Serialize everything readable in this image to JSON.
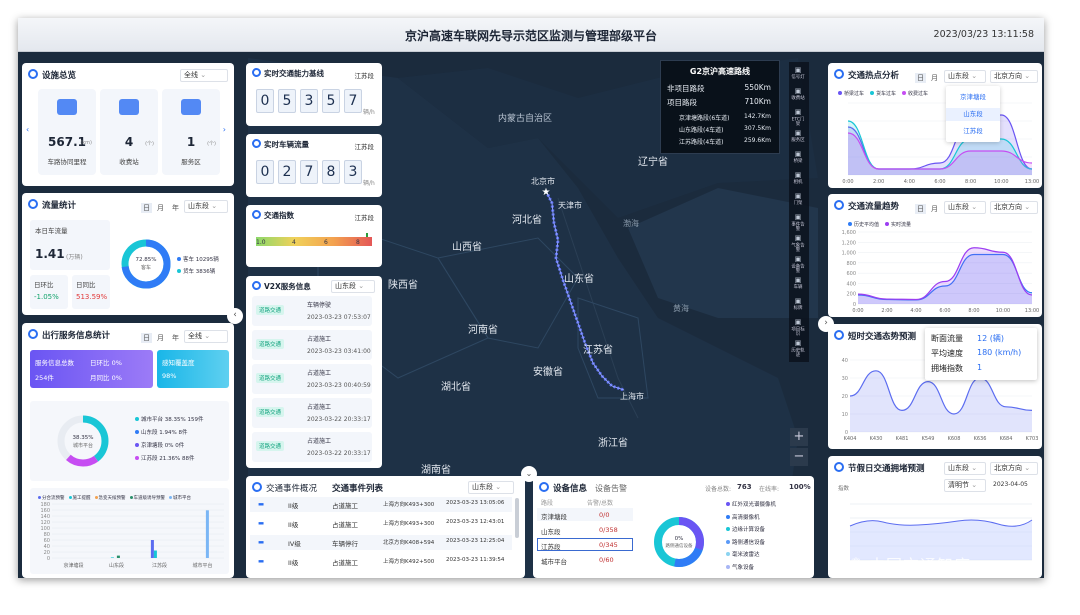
{
  "header": {
    "title": "京沪高速车联网先导示范区监测与管理部级平台",
    "datetime": "2023/03/23 13:11:58"
  },
  "facilities": {
    "title": "设施总览",
    "selector": "全线",
    "items": [
      {
        "value": "567.1",
        "unit": "(km)",
        "label": "车路协同里程"
      },
      {
        "value": "4",
        "unit": "(个)",
        "label": "收费站"
      },
      {
        "value": "1",
        "unit": "(个)",
        "label": "服务区"
      }
    ]
  },
  "flow": {
    "title": "流量统计",
    "tabs": [
      "日",
      "月",
      "年"
    ],
    "selector": "山东段",
    "today_label": "本日车流量",
    "today_value": "1.41",
    "today_unit": "(万辆)",
    "ring_label": "72.85%",
    "ring_sub": "客车",
    "legend": [
      {
        "name": "客车 10295辆",
        "color": "#2f7cf6"
      },
      {
        "name": "货车 3836辆",
        "color": "#19c6d6"
      }
    ],
    "mom_label": "日环比",
    "mom_value": "-1.05%",
    "yoy_label": "日同比",
    "yoy_value": "513.59%"
  },
  "travel": {
    "title": "出行服务信息统计",
    "tabs": [
      "日",
      "月",
      "年"
    ],
    "selector": "全线",
    "card1_title": "服务信息总数",
    "card1_count": "254件",
    "card1_mom": "日环比 0%",
    "card1_yoy": "月同比 0%",
    "card2_title": "感知覆盖度",
    "card2_value": "98%",
    "ring_label": "38.35%",
    "ring_sub": "城市平台",
    "legend": [
      "城市平台 38.35% 159件",
      "山东段 1.94% 8件",
      "京津塘段 0% 0件",
      "江苏段 21.36% 88件"
    ],
    "bar_legend": [
      "分合流预警",
      "施工提醒",
      "急变天候预警",
      "车道级诱导预警",
      "城市平台"
    ],
    "bar_yticks": [
      "180",
      "160",
      "140",
      "120",
      "100",
      "80",
      "60",
      "40",
      "20",
      "0"
    ],
    "bar_x": [
      "京津塘段",
      "山东段",
      "江苏段",
      "城市平台"
    ]
  },
  "capacity": {
    "title": "实时交通能力基线",
    "selector": "江苏段",
    "digits": [
      "0",
      "5",
      "3",
      "5",
      "7"
    ],
    "unit": "辆/h"
  },
  "vehicle": {
    "title": "实时车辆流量",
    "selector": "江苏段",
    "digits": [
      "0",
      "2",
      "7",
      "8",
      "3"
    ],
    "unit": "辆/h"
  },
  "index": {
    "title": "交通指数",
    "selector": "江苏段",
    "ticks": [
      "1.0",
      "4",
      "6",
      "8"
    ]
  },
  "v2x": {
    "title": "V2X服务信息",
    "selector": "山东段",
    "items": [
      {
        "badge": "道路交通",
        "text": "车辆停驶",
        "time": "2023-03-23 07:53:07"
      },
      {
        "badge": "道路交通",
        "text": "占道施工",
        "time": "2023-03-23 03:41:00"
      },
      {
        "badge": "道路交通",
        "text": "占道施工",
        "time": "2023-03-23 00:40:59"
      },
      {
        "badge": "道路交通",
        "text": "占道施工",
        "time": "2023-03-22 20:33:17"
      },
      {
        "badge": "道路交通",
        "text": "占道施工",
        "time": "2023-03-22 20:33:17"
      }
    ]
  },
  "route": {
    "title": "G2京沪高速路线",
    "rows": [
      {
        "k": "非项目路段",
        "v": "550Km"
      },
      {
        "k": "项目路段",
        "v": "710Km"
      },
      {
        "k": "京津塘路段(6车道)",
        "v": "142.7Km"
      },
      {
        "k": "山东路段(4车道)",
        "v": "307.5Km"
      },
      {
        "k": "江苏路段(4车道)",
        "v": "259.6Km"
      }
    ]
  },
  "map": {
    "labels": [
      "内蒙古自治区",
      "北京市",
      "天津市",
      "河北省",
      "辽宁省",
      "山西省",
      "陕西省",
      "山东省",
      "河南省",
      "黄海",
      "江苏省",
      "安徽省",
      "湖北省",
      "上海市",
      "浙江省",
      "湖南省",
      "渤海"
    ]
  },
  "iconbar": [
    "信号灯",
    "收费站",
    "ETC门架",
    "服务区",
    "桥梁",
    "相机",
    "门架",
    "事件告警",
    "气象告警",
    "设备告警",
    "车辆",
    "标牌",
    "项目标识",
    "历史轨迹"
  ],
  "events": {
    "tabs": [
      "交通事件概况",
      "交通事件列表"
    ],
    "selector": "山东段",
    "rows": [
      {
        "level": "II级",
        "type": "占道施工",
        "place": "上海方向K493+300",
        "time": "2023-03-23 13:05:06"
      },
      {
        "level": "II级",
        "type": "占道施工",
        "place": "上海方向K493+300",
        "time": "2023-03-23 12:43:01"
      },
      {
        "level": "IV级",
        "type": "车辆停行",
        "place": "北京方向K408+594",
        "time": "2023-03-23 12:25:04"
      },
      {
        "level": "II级",
        "type": "占道施工",
        "place": "上海方向K492+500",
        "time": "2023-03-23 11:39:54"
      }
    ]
  },
  "devices": {
    "title": "设备信息",
    "tab2": "设备告警",
    "total_label": "设备总数:",
    "total": "763",
    "online_label": "在线率:",
    "online": "100%",
    "col1": "路段",
    "col2": "告警/总数",
    "rows": [
      {
        "name": "京津塘段",
        "v": "0/0"
      },
      {
        "name": "山东段",
        "v": "0/358"
      },
      {
        "name": "江苏段",
        "v": "0/345"
      },
      {
        "name": "城市平台",
        "v": "0/60"
      }
    ],
    "ring_label": "0%",
    "ring_sub": "路侧通信设备",
    "legend": [
      "红外双光谱摄像机",
      "高清摄像机",
      "边缘计算设备",
      "路侧通信设备",
      "毫米波雷达",
      "气象设备"
    ]
  },
  "hotspot": {
    "title": "交通热点分析",
    "tabs": [
      "日",
      "月"
    ],
    "selector": "山东段",
    "dir": "北京方向",
    "legend": [
      "桥梁过车",
      "货车过车",
      "收费过车"
    ],
    "dropdown": [
      "京津塘段",
      "山东段",
      "江苏段"
    ],
    "xticks": [
      "0:00",
      "2:00",
      "4:00",
      "6:00",
      "8:00",
      "10:00",
      "13:00"
    ]
  },
  "trend": {
    "title": "交通流量趋势",
    "tabs": [
      "日",
      "月"
    ],
    "selector": "山东段",
    "dir": "北京方向",
    "legend": [
      "历史平均值",
      "实时流量"
    ],
    "yticks": [
      "1,600",
      "1,200",
      "1,000",
      "800",
      "600",
      "400",
      "200",
      "0"
    ],
    "xticks": [
      "0:00",
      "2:00",
      "4:00",
      "6:00",
      "8:00",
      "10:00",
      "13:00"
    ]
  },
  "short": {
    "title": "短时交通态势预测",
    "tooltip": [
      {
        "k": "断面流量",
        "v": "12 (辆)"
      },
      {
        "k": "平均速度",
        "v": "180 (km/h)"
      },
      {
        "k": "拥堵指数",
        "v": "1"
      }
    ],
    "yticks": [
      "40",
      "30",
      "20",
      "10",
      "0"
    ],
    "xticks": [
      "K404",
      "K430",
      "K481",
      "K549",
      "K608",
      "K636",
      "K684",
      "K703"
    ]
  },
  "holiday": {
    "title": "节假日交通拥堵预测",
    "selector": "山东段",
    "dir": "北京方向",
    "sel2": "清明节",
    "date": "2023-04-05",
    "ylabel": "指数"
  },
  "watermark": "中国交通智库",
  "chart_data": [
    {
      "type": "area",
      "title": "交通热点分析",
      "x": [
        "0:00",
        "2:00",
        "4:00",
        "6:00",
        "8:00",
        "10:00",
        "13:00"
      ],
      "series": [
        {
          "name": "桥梁过车",
          "values": [
            8,
            1,
            1,
            2,
            9,
            10,
            1
          ]
        },
        {
          "name": "货车过车",
          "values": [
            9,
            1,
            1,
            1,
            6,
            6,
            1
          ]
        },
        {
          "name": "收费过车",
          "values": [
            7,
            1,
            1,
            1,
            4,
            4,
            2
          ]
        }
      ],
      "ylim": [
        0,
        12
      ]
    },
    {
      "type": "area",
      "title": "交通流量趋势",
      "x": [
        "0:00",
        "2:00",
        "4:00",
        "6:00",
        "8:00",
        "10:00",
        "13:00"
      ],
      "series": [
        {
          "name": "历史平均值",
          "values": [
            200,
            100,
            90,
            400,
            1100,
            1100,
            250
          ]
        },
        {
          "name": "实时流量",
          "values": [
            220,
            110,
            100,
            500,
            1250,
            1150,
            200
          ]
        }
      ],
      "ylim": [
        0,
        1600
      ]
    },
    {
      "type": "area",
      "title": "短时交通态势预测",
      "x": [
        "K404",
        "K430",
        "K481",
        "K549",
        "K608",
        "K636",
        "K684",
        "K703"
      ],
      "series": [
        {
          "name": "断面流量",
          "values": [
            20,
            34,
            12,
            28,
            10,
            30,
            14,
            12
          ]
        }
      ],
      "ylim": [
        0,
        40
      ]
    },
    {
      "type": "bar",
      "title": "出行服务信息统计",
      "categories": [
        "京津塘段",
        "山东段",
        "江苏段",
        "城市平台"
      ],
      "series": [
        {
          "name": "分合流预警",
          "values": [
            0,
            0,
            60,
            0
          ]
        },
        {
          "name": "施工提醒",
          "values": [
            0,
            2,
            25,
            0
          ]
        },
        {
          "name": "急变天候预警",
          "values": [
            0,
            0,
            0,
            0
          ]
        },
        {
          "name": "车道级诱导预警",
          "values": [
            0,
            8,
            0,
            0
          ]
        },
        {
          "name": "城市平台",
          "values": [
            0,
            0,
            0,
            159
          ]
        }
      ],
      "ylim": [
        0,
        180
      ]
    }
  ]
}
